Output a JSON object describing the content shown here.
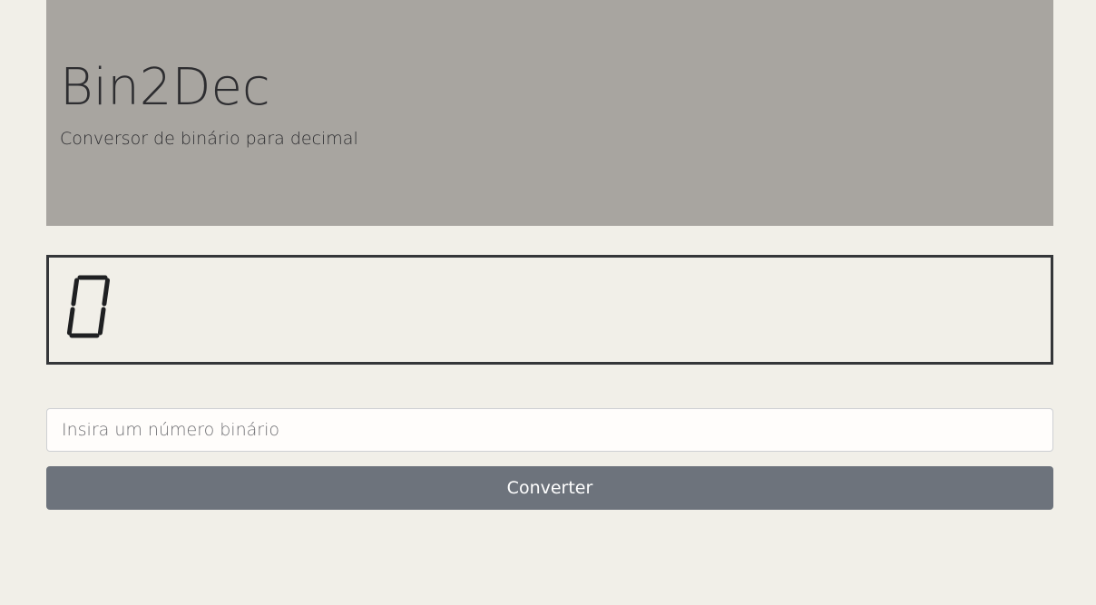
{
  "header": {
    "title": "Bin2Dec",
    "subtitle": "Conversor de binário para decimal"
  },
  "display": {
    "value": "0"
  },
  "form": {
    "input_value": "",
    "input_placeholder": "Insira um número binário",
    "convert_label": "Converter"
  },
  "colors": {
    "background": "#f1efe8",
    "hero_background": "#a8a5a0",
    "display_border": "#343639",
    "segment_on": "#1f2022",
    "button_background": "#6d737c",
    "button_text": "#ffffff"
  }
}
